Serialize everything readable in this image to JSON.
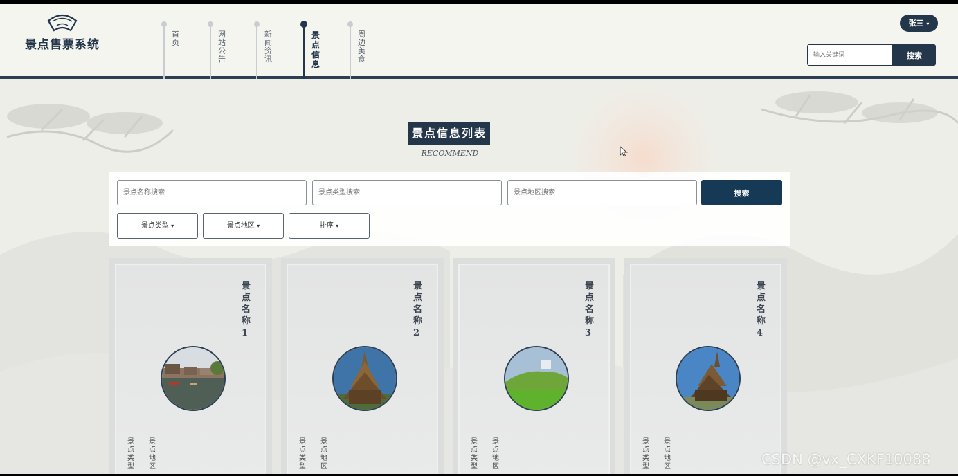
{
  "header": {
    "site_title": "景点售票系统",
    "nav": [
      {
        "label": "首页"
      },
      {
        "label": "网站公告"
      },
      {
        "label": "新闻资讯"
      },
      {
        "label": "景点信息",
        "active": true
      },
      {
        "label": "周边美食"
      }
    ],
    "user_name": "张三",
    "search_placeholder": "输入关键词",
    "search_button": "搜索"
  },
  "main": {
    "title": "景点信息列表",
    "subtitle": "RECOMMEND",
    "filters": {
      "name_placeholder": "景点名称搜索",
      "type_placeholder": "景点类型搜索",
      "area_placeholder": "景点地区搜索",
      "search_button": "搜索",
      "dropdowns": [
        "景点类型",
        "景点地区",
        "排序"
      ]
    },
    "cards": [
      {
        "name": "景点名称1",
        "field1": "景点类型",
        "field2": "景点地区"
      },
      {
        "name": "景点名称2",
        "field1": "景点类型",
        "field2": "景点地区"
      },
      {
        "name": "景点名称3",
        "field1": "景点类型",
        "field2": "景点地区"
      },
      {
        "name": "景点名称4",
        "field1": "景点类型",
        "field2": "景点地区"
      }
    ]
  },
  "watermark": "CSDN @vx_CXKF10088",
  "colors": {
    "primary": "#23364a",
    "accent_button": "#163a55",
    "background": "#eeeee8"
  }
}
